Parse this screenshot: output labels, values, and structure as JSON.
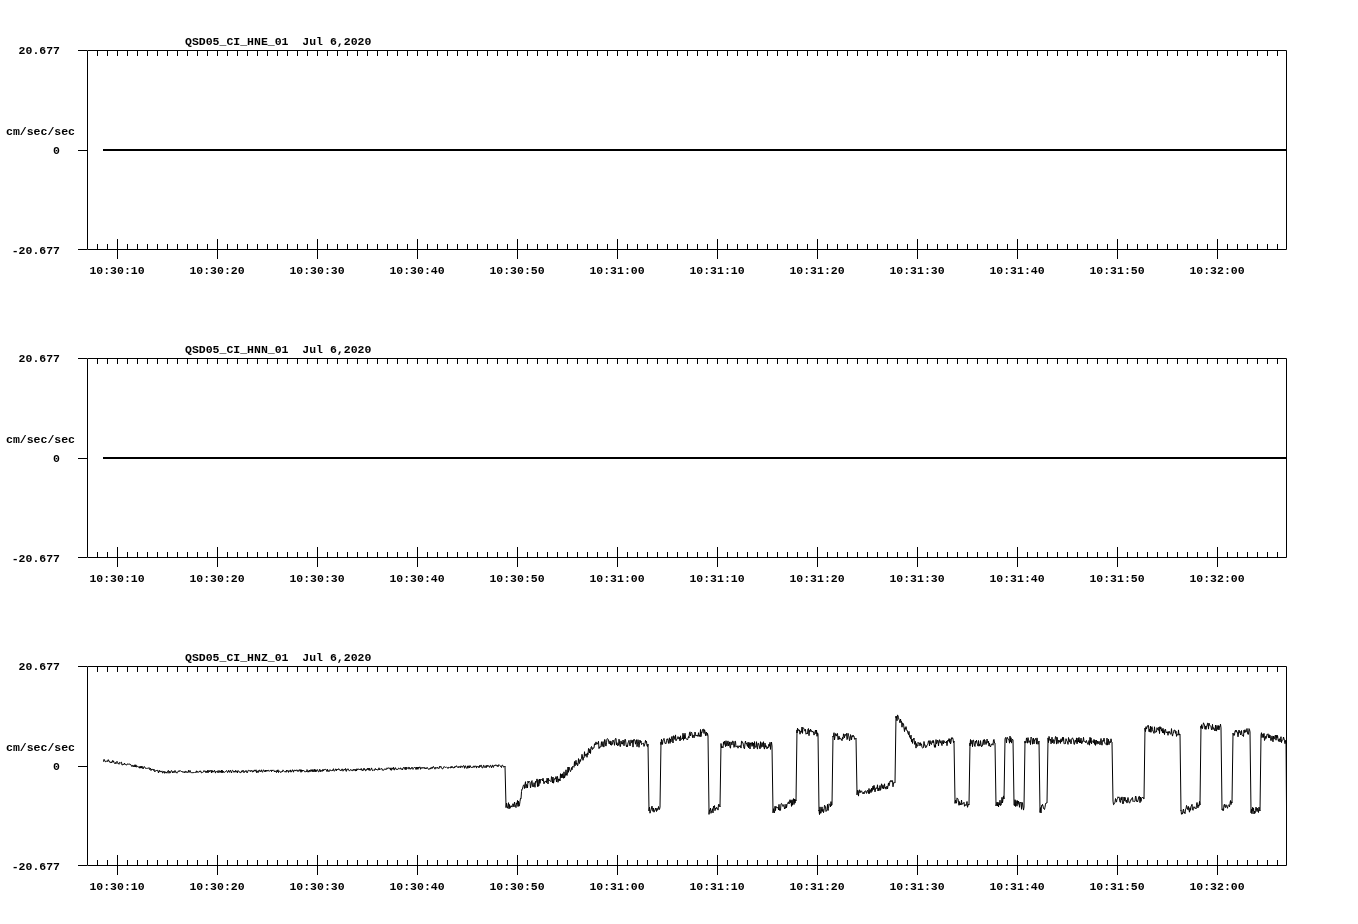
{
  "panels": [
    {
      "title": "QSD05_CI_HNE_01  Jul 6,2020",
      "kind": "flat",
      "y_max": "20.677",
      "y_zero": "0",
      "y_min": "-20.677",
      "unit": "cm/sec/sec",
      "x_labels": [
        "10:30:10",
        "10:30:20",
        "10:30:30",
        "10:30:40",
        "10:30:50",
        "10:31:00",
        "10:31:10",
        "10:31:20",
        "10:31:30",
        "10:31:40",
        "10:31:50",
        "10:32:00"
      ]
    },
    {
      "title": "QSD05_CI_HNN_01  Jul 6,2020",
      "kind": "flat",
      "y_max": "20.677",
      "y_zero": "0",
      "y_min": "-20.677",
      "unit": "cm/sec/sec",
      "x_labels": [
        "10:30:10",
        "10:30:20",
        "10:30:30",
        "10:30:40",
        "10:30:50",
        "10:31:00",
        "10:31:10",
        "10:31:20",
        "10:31:30",
        "10:31:40",
        "10:31:50",
        "10:32:00"
      ]
    },
    {
      "title": "QSD05_CI_HNZ_01  Jul 6,2020",
      "kind": "signal",
      "y_max": "20.677",
      "y_zero": "0",
      "y_min": "-20.677",
      "unit": "cm/sec/sec",
      "x_labels": [
        "10:30:10",
        "10:30:20",
        "10:30:30",
        "10:30:40",
        "10:30:50",
        "10:31:00",
        "10:31:10",
        "10:31:20",
        "10:31:30",
        "10:31:40",
        "10:31:50",
        "10:32:00"
      ]
    }
  ]
}
